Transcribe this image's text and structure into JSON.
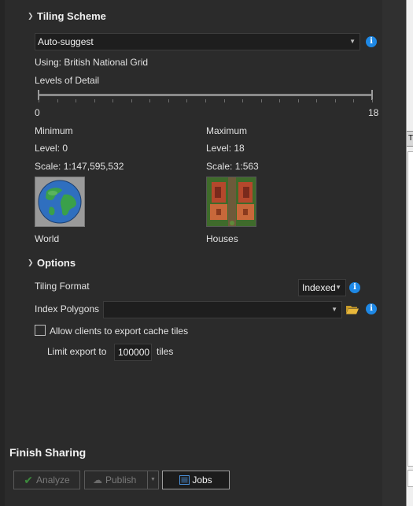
{
  "tiling_scheme": {
    "heading": "Tiling Scheme",
    "scheme_value": "Auto-suggest",
    "using_label": "Using:",
    "using_value": "British National Grid",
    "lod_label": "Levels of Detail",
    "slider_min": "0",
    "slider_max": "18",
    "minimum": {
      "title": "Minimum",
      "level_label": "Level:",
      "level_value": "0",
      "scale_label": "Scale:",
      "scale_value": "1:147,595,532",
      "caption": "World"
    },
    "maximum": {
      "title": "Maximum",
      "level_label": "Level:",
      "level_value": "18",
      "scale_label": "Scale:",
      "scale_value": "1:563",
      "caption": "Houses"
    }
  },
  "options": {
    "heading": "Options",
    "tiling_format_label": "Tiling Format",
    "tiling_format_value": "Indexed",
    "index_polygons_label": "Index Polygons",
    "index_polygons_value": "",
    "allow_export_label": "Allow clients to export cache tiles",
    "allow_export_checked": false,
    "limit_export_label": "Limit export to",
    "limit_export_value": "100000",
    "limit_export_unit": "tiles"
  },
  "finish": {
    "title": "Finish Sharing",
    "analyze_label": "Analyze",
    "publish_label": "Publish",
    "jobs_label": "Jobs"
  },
  "colors": {
    "panel_bg": "#2b2b2b",
    "info_blue": "#1e88e5",
    "analyze_green": "#3c8a3c",
    "folder_yellow": "#e8b73a"
  }
}
